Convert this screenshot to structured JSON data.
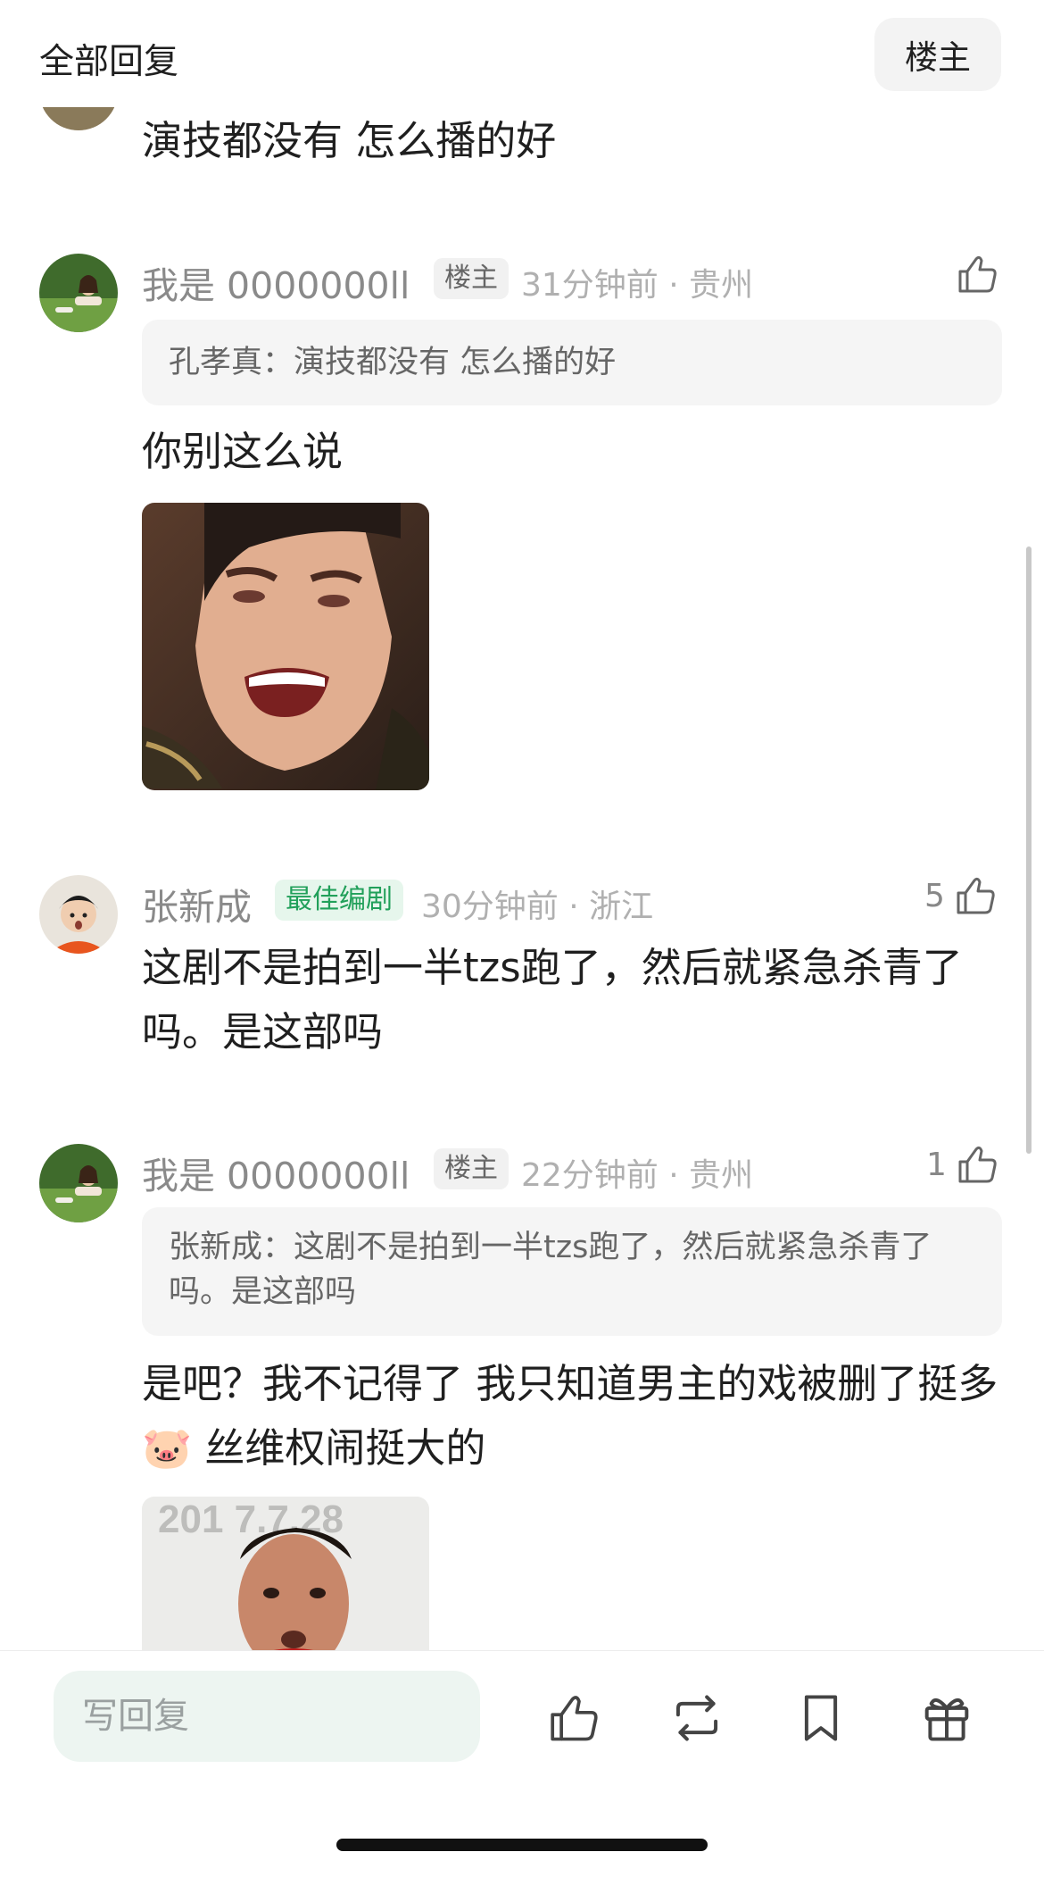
{
  "header": {
    "title": "全部回复",
    "op_button": "楼主"
  },
  "comments": [
    {
      "text": "演技都没有 怎么播的好"
    },
    {
      "name": "我是 0000000ll",
      "tag": "楼主",
      "time": "31分钟前 · 贵州",
      "quote": "孔孝真：演技都没有 怎么播的好",
      "text": "你别这么说",
      "image": "crying-laughing-man-meme"
    },
    {
      "name": "张新成",
      "tag": "最佳编剧",
      "time": "30分钟前 · 浙江",
      "likes": "5",
      "text": "这剧不是拍到一半tzs跑了，然后就紧急杀青了吗。是这部吗"
    },
    {
      "name": "我是 0000000ll",
      "tag": "楼主",
      "time": "22分钟前 · 贵州",
      "likes": "1",
      "quote": "张新成：这剧不是拍到一半tzs跑了，然后就紧急杀青了吗。是这部吗",
      "text": "是吧？我不记得了 我只知道男主的戏被删了挺多 🐷 丝维权闹挺大的",
      "image": "surprised-man-meme",
      "image_text": "201 7.7.28"
    }
  ],
  "bottom_bar": {
    "reply_placeholder": "写回复"
  },
  "icons": [
    "thumbs-up-icon",
    "repost-icon",
    "bookmark-icon",
    "gift-icon"
  ],
  "colors": {
    "best_tag_text": "#21a05a",
    "best_tag_bg": "#e6f6ec",
    "input_bg": "#edf5f1"
  }
}
